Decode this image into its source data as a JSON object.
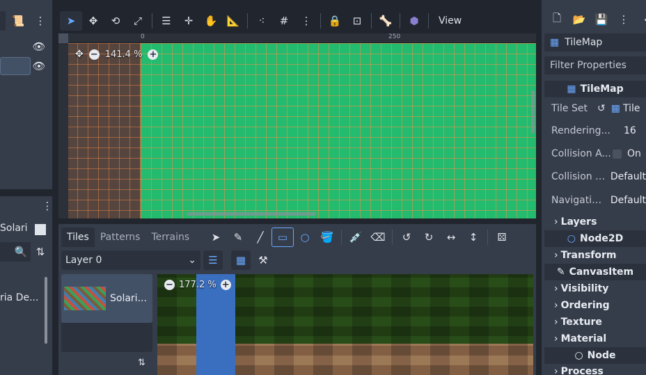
{
  "left_dock": {
    "scene_items": [
      {
        "visible_icon": "eye-icon"
      },
      {
        "visible_icon": "eye-icon"
      }
    ],
    "filesystem": {
      "crumb_label": "Solari",
      "file_label": "ria De..."
    }
  },
  "toolbar": {
    "tools": [
      "select-icon",
      "move-icon",
      "rotate-icon",
      "scale-icon",
      "list-select-icon",
      "pivot-icon",
      "pan-icon",
      "ruler-icon",
      "smart-snap-icon",
      "grid-snap-icon",
      "more-icon",
      "lock-icon",
      "group-icon",
      "bone-icon",
      "camera-icon"
    ],
    "view_label": "View"
  },
  "viewport": {
    "zoom": "141.4 %",
    "ruler_marks": [
      "0",
      "250"
    ]
  },
  "tile_panel": {
    "tabs": [
      "Tiles",
      "Patterns",
      "Terrains"
    ],
    "active_tab": "Tiles",
    "layer": "Layer 0",
    "source_name": "Solari...",
    "atlas_zoom": "177.2 %"
  },
  "inspector": {
    "node_name": "TileMap",
    "filter_placeholder": "Filter Properties",
    "class_header": "TileMap",
    "props": [
      {
        "label": "Tile Set",
        "value": "Tile"
      },
      {
        "label": "Rendering...",
        "value": "16"
      },
      {
        "label": "Collision A...",
        "value": "On"
      },
      {
        "label": "Collision V...",
        "value": "Default"
      },
      {
        "label": "Navigatio...",
        "value": "Default"
      }
    ],
    "layers_group": "Layers",
    "node2d_header": "Node2D",
    "transform_group": "Transform",
    "canvasitem_header": "CanvasItem",
    "canvas_groups": [
      "Visibility",
      "Ordering",
      "Texture",
      "Material"
    ],
    "node_header": "Node",
    "process_group": "Process"
  }
}
